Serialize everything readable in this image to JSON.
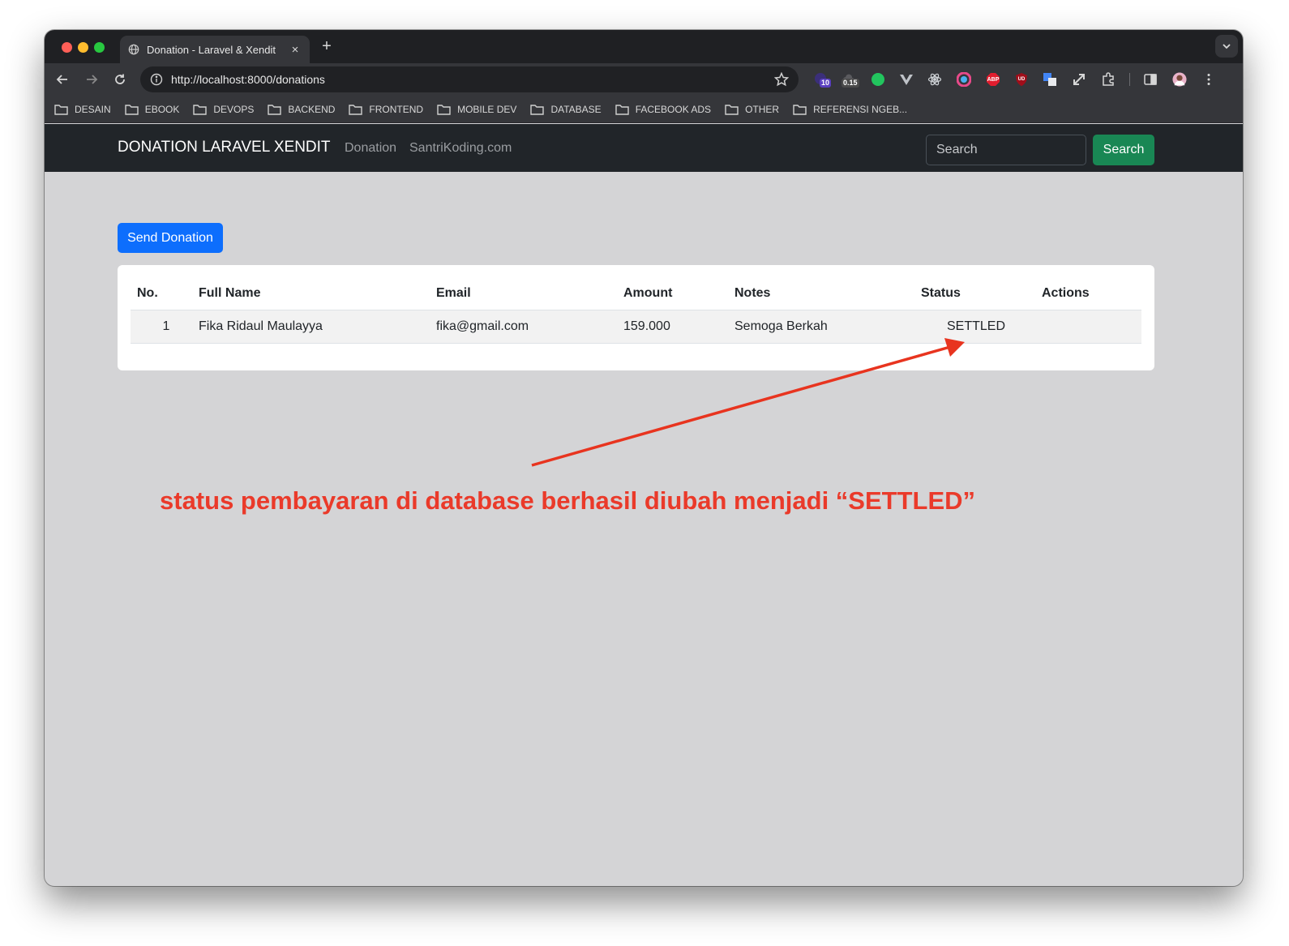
{
  "browser": {
    "tab_title": "Donation - Laravel & Xendit",
    "new_tab": "+",
    "url": "http://localhost:8000/donations",
    "extensions": [
      {
        "icon": "puzzle-badge-icon",
        "badge": "10"
      },
      {
        "icon": "cloud-metric-icon",
        "badge": "0.15"
      },
      {
        "icon": "green-dot-icon"
      },
      {
        "icon": "vue-devtools-icon"
      },
      {
        "icon": "react-devtools-icon"
      },
      {
        "icon": "color-picker-icon"
      },
      {
        "icon": "adblock-icon",
        "badge": "ABP"
      },
      {
        "icon": "ublock-icon",
        "badge": "UD"
      },
      {
        "icon": "translate-icon"
      },
      {
        "icon": "expand-icon"
      },
      {
        "icon": "extensions-puzzle-icon"
      }
    ],
    "bookmarks": [
      "DESAIN",
      "EBOOK",
      "DEVOPS",
      "BACKEND",
      "FRONTEND",
      "MOBILE DEV",
      "DATABASE",
      "FACEBOOK ADS",
      "OTHER",
      "REFERENSI NGEB..."
    ],
    "colors": {
      "chrome_dark": "#1f2023",
      "toolbar": "#35363a"
    }
  },
  "navbar": {
    "brand": "DONATION LARAVEL XENDIT",
    "links": [
      "Donation",
      "SantriKoding.com"
    ],
    "search_placeholder": "Search",
    "search_button": "Search"
  },
  "main": {
    "send_button": "Send Donation",
    "table": {
      "headers": [
        "No.",
        "Full Name",
        "Email",
        "Amount",
        "Notes",
        "Status",
        "Actions"
      ],
      "rows": [
        {
          "no": "1",
          "full_name": "Fika Ridaul Maulayya",
          "email": "fika@gmail.com",
          "amount": "159.000",
          "notes": "Semoga Berkah",
          "status": "SETTLED",
          "actions": ""
        }
      ]
    }
  },
  "annotation": {
    "text": "status pembayaran di database berhasil diubah menjadi “SETTLED”",
    "color": "#ea3a2a"
  }
}
